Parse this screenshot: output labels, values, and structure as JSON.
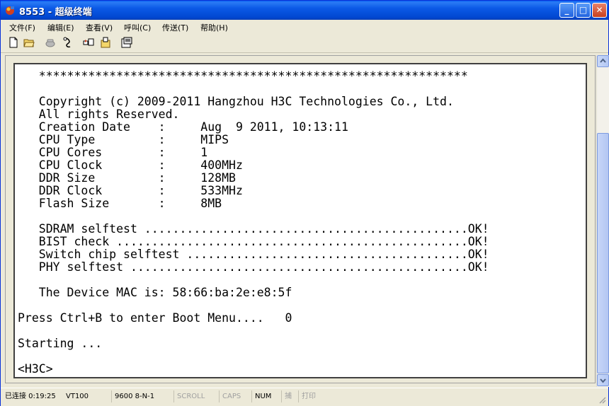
{
  "window": {
    "title": "8553 - 超级终端"
  },
  "menu": [
    {
      "label": "文件(F)"
    },
    {
      "label": "编辑(E)"
    },
    {
      "label": "查看(V)"
    },
    {
      "label": "呼叫(C)"
    },
    {
      "label": "传送(T)"
    },
    {
      "label": "帮助(H)"
    }
  ],
  "toolbar": [
    {
      "icon": "new-file-icon"
    },
    {
      "icon": "open-folder-icon"
    },
    {
      "icon": "phone-icon"
    },
    {
      "icon": "disconnect-icon"
    },
    {
      "icon": "send-icon"
    },
    {
      "icon": "receive-icon"
    },
    {
      "icon": "properties-icon"
    }
  ],
  "terminal": {
    "lines": [
      "   *************************************************************",
      "",
      "   Copyright (c) 2009-2011 Hangzhou H3C Technologies Co., Ltd.",
      "   All rights Reserved.",
      "   Creation Date    :     Aug  9 2011, 10:13:11",
      "   CPU Type         :     MIPS",
      "   CPU Cores        :     1",
      "   CPU Clock        :     400MHz",
      "   DDR Size         :     128MB",
      "   DDR Clock        :     533MHz",
      "   Flash Size       :     8MB",
      "",
      "   SDRAM selftest ..............................................OK!",
      "   BIST check ..................................................OK!",
      "   Switch chip selftest ........................................OK!",
      "   PHY selftest ................................................OK!",
      "",
      "   The Device MAC is: 58:66:ba:2e:e8:5f",
      "",
      "Press Ctrl+B to enter Boot Menu....   0",
      "",
      "Starting ...",
      "",
      "<H3C>"
    ]
  },
  "status": {
    "connected": "已连接 0:19:25",
    "emulation": "VT100",
    "port_settings": "9600 8-N-1",
    "scroll": "SCROLL",
    "caps": "CAPS",
    "num": "NUM",
    "capture": "捕",
    "print": "打印"
  }
}
